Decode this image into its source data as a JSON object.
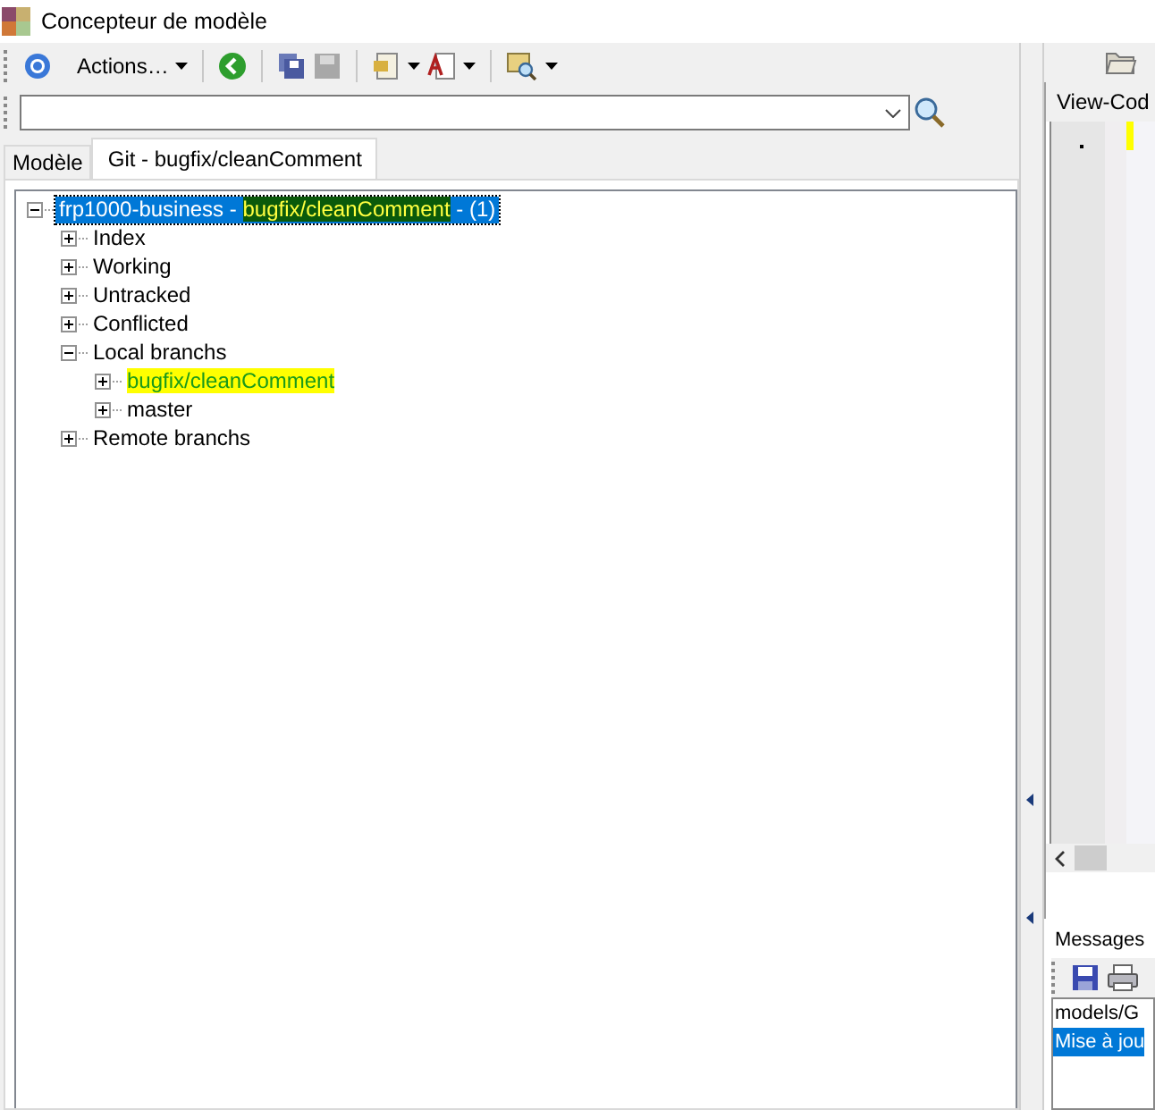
{
  "window": {
    "title": "Concepteur de modèle"
  },
  "toolbar": {
    "actions_label": "Actions…"
  },
  "tabs": [
    {
      "label": "Modèle",
      "selected": false
    },
    {
      "label": "Git - bugfix/cleanComment",
      "selected": true
    }
  ],
  "tree": [
    {
      "parts": [
        {
          "text": "frp1000-business - ",
          "highlight": false
        },
        {
          "text": "bugfix/cleanComment",
          "highlight": true
        },
        {
          "text": " - (1)",
          "highlight": false
        }
      ],
      "expanded": true,
      "selected": true,
      "children": [
        {
          "parts": [
            {
              "text": "Index",
              "highlight": false
            }
          ],
          "expanded": false,
          "selected": false
        },
        {
          "parts": [
            {
              "text": "Working",
              "highlight": false
            }
          ],
          "expanded": false,
          "selected": false
        },
        {
          "parts": [
            {
              "text": "Untracked",
              "highlight": false
            }
          ],
          "expanded": false,
          "selected": false
        },
        {
          "parts": [
            {
              "text": "Conflicted",
              "highlight": false
            }
          ],
          "expanded": false,
          "selected": false
        },
        {
          "parts": [
            {
              "text": "Local branchs",
              "highlight": false
            }
          ],
          "expanded": true,
          "selected": false,
          "children": [
            {
              "parts": [
                {
                  "text": "bugfix/cleanComment",
                  "highlight": true
                }
              ],
              "expanded": false,
              "selected": false
            },
            {
              "parts": [
                {
                  "text": "master",
                  "highlight": false
                }
              ],
              "expanded": false,
              "selected": false
            }
          ]
        },
        {
          "parts": [
            {
              "text": "Remote branchs",
              "highlight": false
            }
          ],
          "expanded": false,
          "selected": false
        }
      ]
    }
  ],
  "code_tab": {
    "label": "View-Cod"
  },
  "messages": {
    "title": "Messages",
    "rows": [
      {
        "text": "models/G",
        "selected": false
      },
      {
        "text": "Mise à jou",
        "selected": true
      }
    ]
  }
}
